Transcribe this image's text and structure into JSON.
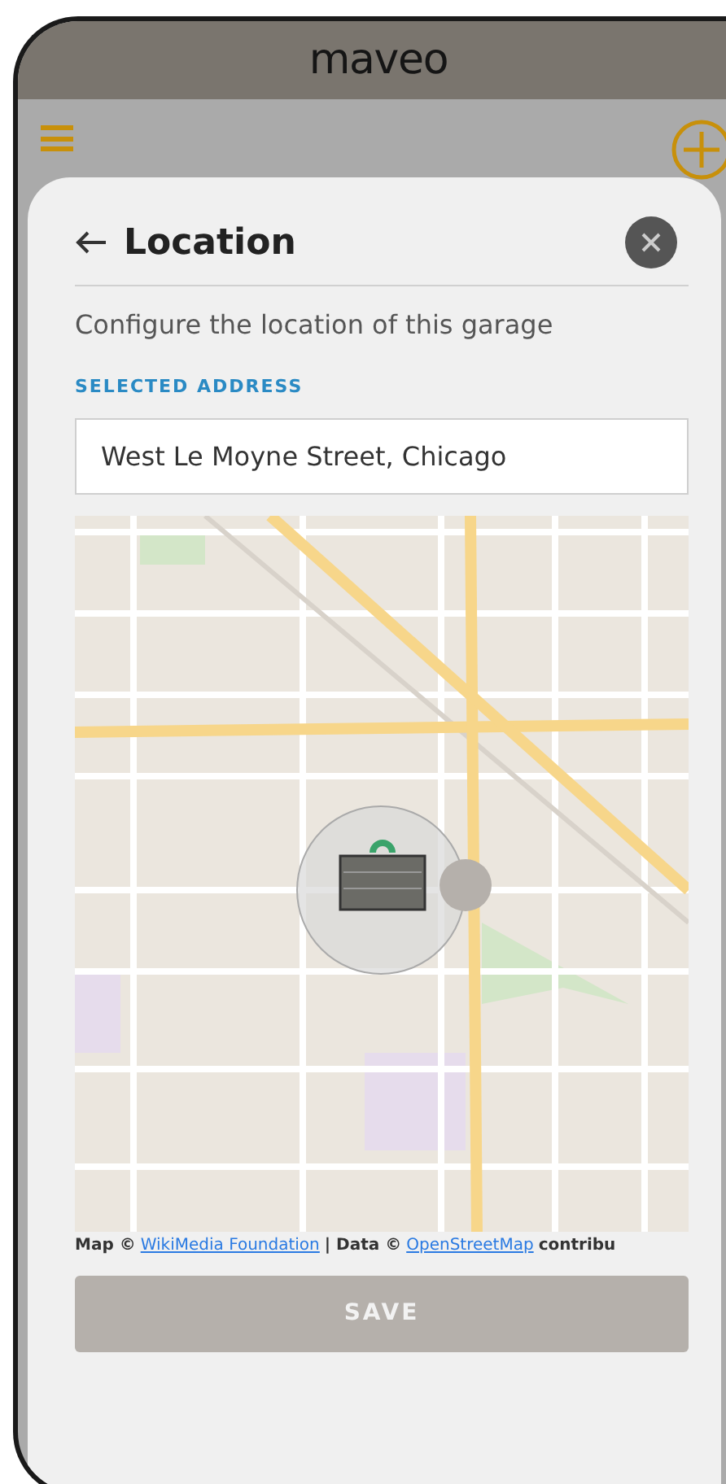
{
  "app_bar": {
    "logo": "maveo"
  },
  "dialog": {
    "title": "Location",
    "description": "Configure the location of this garage",
    "field_label": "SELECTED ADDRESS",
    "address": {
      "value": "West Le Moyne Street, Chicago"
    },
    "attribution": [
      {
        "kind": "text",
        "text": "Map ©"
      },
      {
        "kind": "link",
        "text": "WikiMedia Foundation"
      },
      {
        "kind": "text",
        "text": "| Data ©"
      },
      {
        "kind": "link",
        "text": "OpenStreetMap"
      },
      {
        "kind": "text",
        "text": "contribu"
      }
    ],
    "save_button": {
      "label": "SAVE",
      "disabled": true
    }
  }
}
